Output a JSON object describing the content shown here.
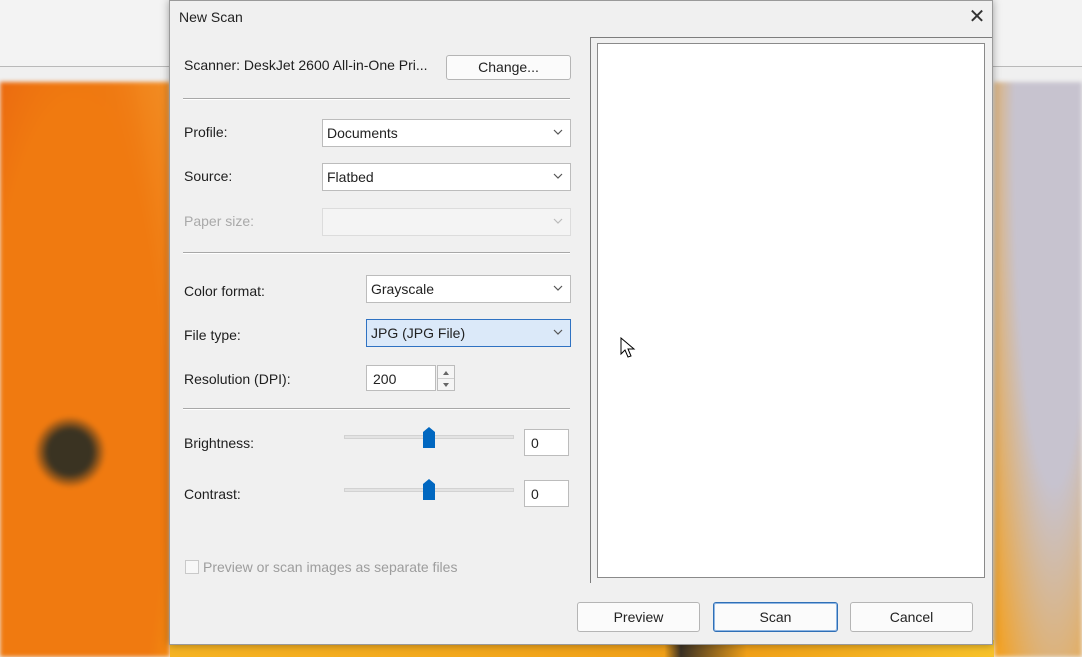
{
  "dialog": {
    "title": "New Scan",
    "close_glyph": "✕"
  },
  "scanner": {
    "label": "Scanner: DeskJet 2600 All-in-One Pri...",
    "change_button": "Change..."
  },
  "profile": {
    "label": "Profile:",
    "value": "Documents"
  },
  "source": {
    "label": "Source:",
    "value": "Flatbed"
  },
  "paper_size": {
    "label": "Paper size:",
    "value": ""
  },
  "color_format": {
    "label": "Color format:",
    "value": "Grayscale"
  },
  "file_type": {
    "label": "File type:",
    "value": "JPG (JPG File)"
  },
  "resolution": {
    "label": "Resolution (DPI):",
    "value": "200"
  },
  "brightness": {
    "label": "Brightness:",
    "value": "0",
    "slider_fraction": 0.5
  },
  "contrast": {
    "label": "Contrast:",
    "value": "0",
    "slider_fraction": 0.5
  },
  "separate_files": {
    "label": "Preview or scan images as separate files",
    "checked": false
  },
  "buttons": {
    "preview": "Preview",
    "scan": "Scan",
    "cancel": "Cancel"
  },
  "colors": {
    "accent": "#0067c0",
    "focus_fill": "#dbe9f9"
  },
  "icons": {
    "close": "close-icon",
    "dropdown": "chevron-down-icon",
    "slider": "slider-thumb",
    "cursor": "mouse-pointer-icon"
  }
}
